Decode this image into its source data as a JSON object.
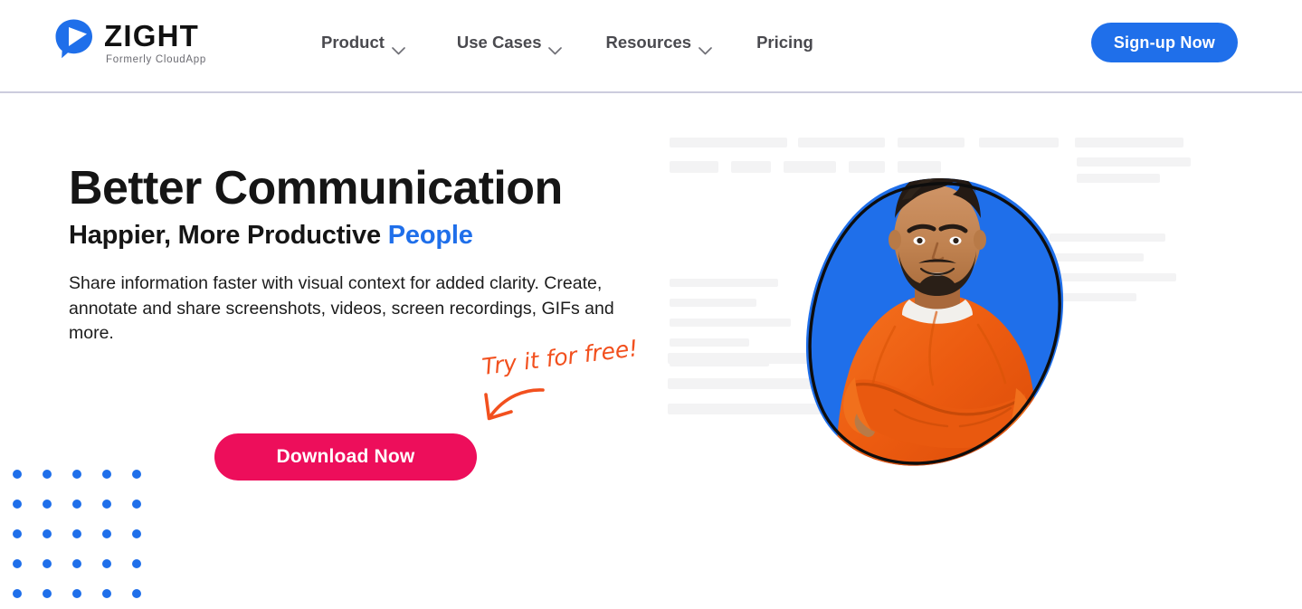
{
  "brand": {
    "wordmark": "ZIGHT",
    "tagline": "Formerly CloudApp",
    "logo_icon": "chat-bubble-play-icon",
    "accent_blue": "#1f6fea",
    "accent_pink": "#ed0e5b",
    "accent_orange": "#f2501e"
  },
  "nav": {
    "items": [
      {
        "label": "Product",
        "has_dropdown": true,
        "icon": "chevron-down-icon"
      },
      {
        "label": "Use Cases",
        "has_dropdown": true,
        "icon": "chevron-down-icon"
      },
      {
        "label": "Resources",
        "has_dropdown": true,
        "icon": "chevron-down-icon"
      },
      {
        "label": "Pricing",
        "has_dropdown": false,
        "icon": ""
      }
    ],
    "signup_label": "Sign-up Now"
  },
  "hero": {
    "headline_line1": "Better Communication",
    "headline_line2_plain": "Happier, More Productive ",
    "headline_line2_accent": "People",
    "subcopy": "Share information faster with visual context for added clarity. Create, annotate and share screenshots, videos, screen recordings, GIFs and more.",
    "cta_label": "Download Now",
    "annotation_text": "Try it for free!",
    "annotation_arrow_icon": "curved-arrow-down-left-icon",
    "image_alt": "smiling-man-orange-sweatshirt-arms-crossed",
    "decoration": "blue-dot-grid-5x5"
  }
}
